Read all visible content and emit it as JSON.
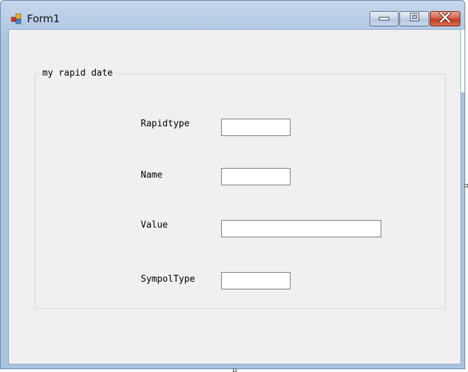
{
  "window": {
    "title": "Form1",
    "icon": "winforms-app-icon",
    "caption_buttons": {
      "minimize": "minimize-icon",
      "maximize": "maximize-icon",
      "close": "close-icon"
    }
  },
  "group": {
    "caption": "my rapid date"
  },
  "fields": {
    "rapidtype": {
      "label": "Rapidtype",
      "value": ""
    },
    "name": {
      "label": "Name",
      "value": ""
    },
    "value": {
      "label": "Value",
      "value": ""
    },
    "sympoltype": {
      "label": "SympolType",
      "value": ""
    }
  },
  "colors": {
    "frame": "#a9c2e0",
    "client": "#f0f0f0",
    "close_button": "#c23b21"
  }
}
